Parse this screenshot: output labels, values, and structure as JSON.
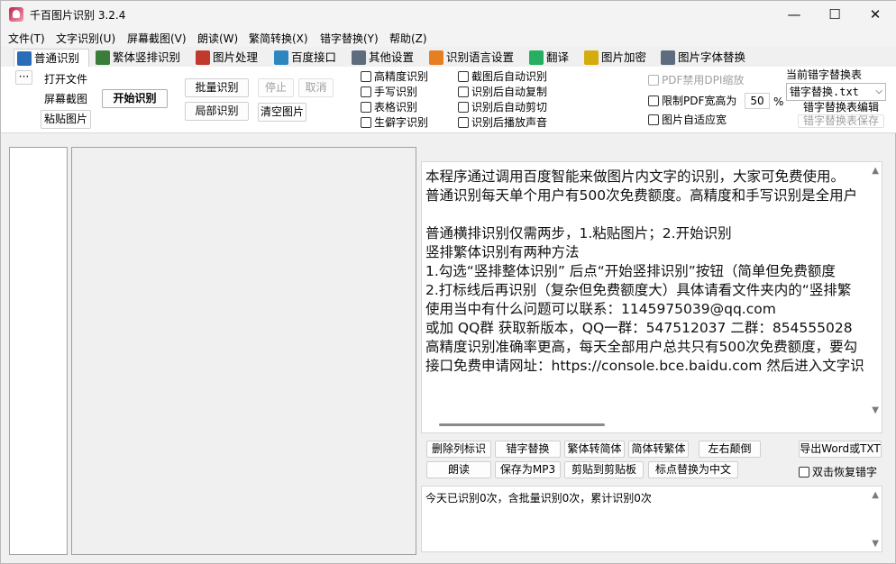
{
  "window": {
    "title": "千百图片识别 3.2.4",
    "minimize_glyph": "—",
    "maximize_glyph": "☐",
    "close_glyph": "✕"
  },
  "menu": [
    "文件(T)",
    "文字识别(U)",
    "屏幕截图(V)",
    "朗读(W)",
    "繁简转换(X)",
    "错字替换(Y)",
    "帮助(Z)"
  ],
  "tabs": [
    {
      "label": "普通识别",
      "icon": "monitor-icon",
      "color": "#2b6cb8"
    },
    {
      "label": "繁体竖排识别",
      "icon": "image-icon",
      "color": "#3a7d3a"
    },
    {
      "label": "图片处理",
      "icon": "paint-icon",
      "color": "#c0392b"
    },
    {
      "label": "百度接口",
      "icon": "network-icon",
      "color": "#2e86c1"
    },
    {
      "label": "其他设置",
      "icon": "settings-doc-icon",
      "color": "#5d6d7e"
    },
    {
      "label": "识别语言设置",
      "icon": "rss-icon",
      "color": "#e67e22"
    },
    {
      "label": "翻译",
      "icon": "translate-icon",
      "color": "#27ae60"
    },
    {
      "label": "图片加密",
      "icon": "lock-icon",
      "color": "#d4ac0d"
    },
    {
      "label": "图片字体替换",
      "icon": "font-replace-icon",
      "color": "#5d6d7e"
    }
  ],
  "toolbar": {
    "more": "···",
    "open_file": "打开文件",
    "screenshot": "屏幕截图",
    "paste_image": "粘贴图片",
    "start": "开始识别",
    "batch": "批量识别",
    "stop": "停止",
    "cancel": "取消",
    "local": "局部识别",
    "clear_image": "清空图片"
  },
  "options": {
    "col1": [
      "高精度识别",
      "手写识别",
      "表格识别",
      "生僻字识别"
    ],
    "col2": [
      "截图后自动识别",
      "识别后自动复制",
      "识别后自动剪切",
      "识别后播放声音"
    ],
    "pdf_dpi": "PDF禁用DPI缩放",
    "limit_pdf_width": "限制PDF宽高为",
    "limit_value": "50",
    "percent": "%",
    "adaptive_width": "图片自适应宽"
  },
  "replace": {
    "label": "当前错字替换表",
    "selected": "错字替换.txt",
    "edit": "错字替换表编辑",
    "save": "错字替换表保存"
  },
  "result_lines": [
    "本程序通过调用百度智能来做图片内文字的识别，大家可免费使用。",
    "普通识别每天单个用户有500次免费额度。高精度和手写识别是全用户",
    "",
    "普通横排识别仅需两步，1.粘贴图片；2.开始识别",
    "竖排繁体识别有两种方法",
    "1.勾选“竖排整体识别” 后点“开始竖排识别”按钮（简单但免费额度",
    "2.打标线后再识别（复杂但免费额度大）具体请看文件夹内的“竖排繁",
    "使用当中有什么问题可以联系：1145975039@qq.com",
    "或加 QQ群 获取新版本，QQ一群：547512037 二群：854555028",
    "高精度识别准确率更高，每天全部用户总共只有500次免费额度，要勾",
    "接口免费申请网址：https://console.bce.baidu.com  然后进入文字识"
  ],
  "actions": {
    "remove_marks": "删除列标识",
    "replace_typos": "错字替换",
    "to_simplified": "繁体转简体",
    "to_traditional": "简体转繁体",
    "flip": "左右颠倒",
    "export": "导出Word或TXT",
    "read": "朗读",
    "save_mp3": "保存为MP3",
    "cut_clipboard": "剪贴到剪贴板",
    "punct_to_cn": "标点替换为中文",
    "double_click_restore": "双击恢复错字"
  },
  "status": "今天已识别0次，含批量识别0次，累计识别0次"
}
